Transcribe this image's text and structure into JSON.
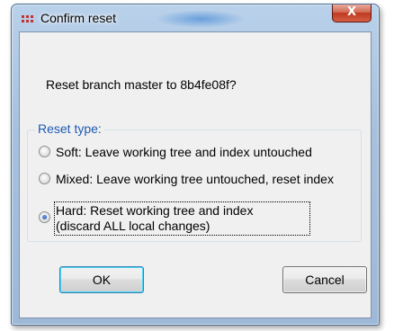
{
  "dialog": {
    "title": "Confirm reset",
    "close_label": "X",
    "question": "Reset branch master to 8b4fe08f?",
    "reset_type": {
      "label": "Reset type:",
      "options": [
        {
          "label": "Soft: Leave working tree and index untouched",
          "checked": false
        },
        {
          "label": "Mixed: Leave working tree untouched, reset index",
          "checked": false
        },
        {
          "label": "Hard: Reset working tree and index",
          "label_line2": "(discard ALL local changes)",
          "checked": true
        }
      ]
    },
    "buttons": {
      "ok": "OK",
      "cancel": "Cancel"
    }
  },
  "colors": {
    "group_label": "#1d5ab4",
    "close_button": "#c0391f",
    "title_icon": "#c3332f",
    "client_background": "#f0f0f0"
  },
  "icons": {
    "title": "git-gui-icon",
    "close": "close-icon"
  }
}
